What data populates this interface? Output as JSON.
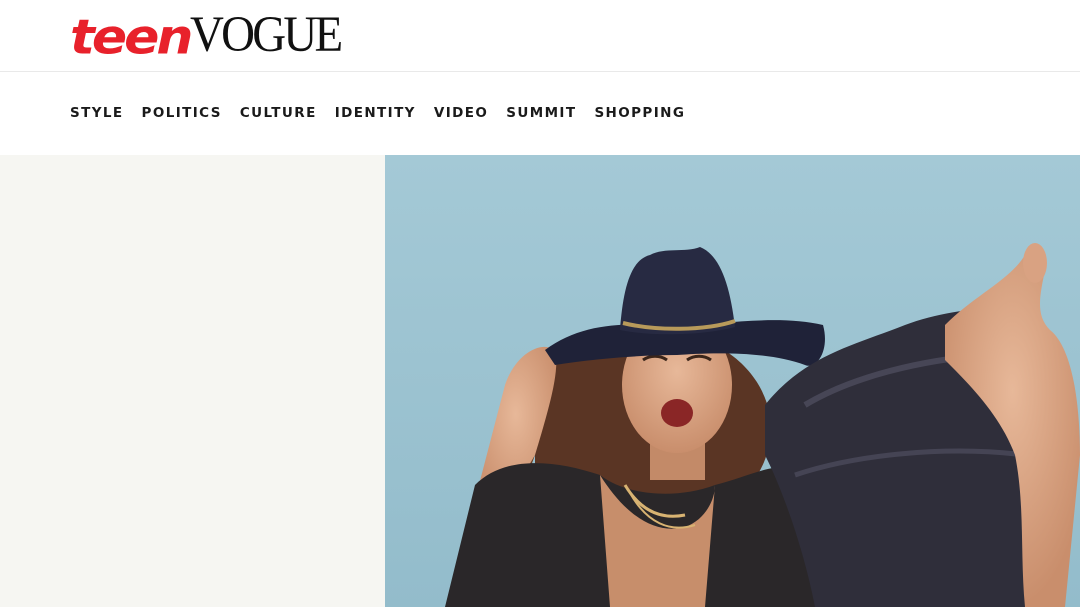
{
  "header": {
    "logo_teen": "teen",
    "logo_vogue": "VOGUE",
    "brand_color": "#e8212b"
  },
  "nav": {
    "items": [
      {
        "label": "STYLE"
      },
      {
        "label": "POLITICS"
      },
      {
        "label": "CULTURE"
      },
      {
        "label": "IDENTITY"
      },
      {
        "label": "VIDEO"
      },
      {
        "label": "SUMMIT"
      },
      {
        "label": "SHOPPING"
      }
    ]
  },
  "hero": {
    "sky_color": "#9cc4d3",
    "panel_color": "#f6f6f2"
  }
}
